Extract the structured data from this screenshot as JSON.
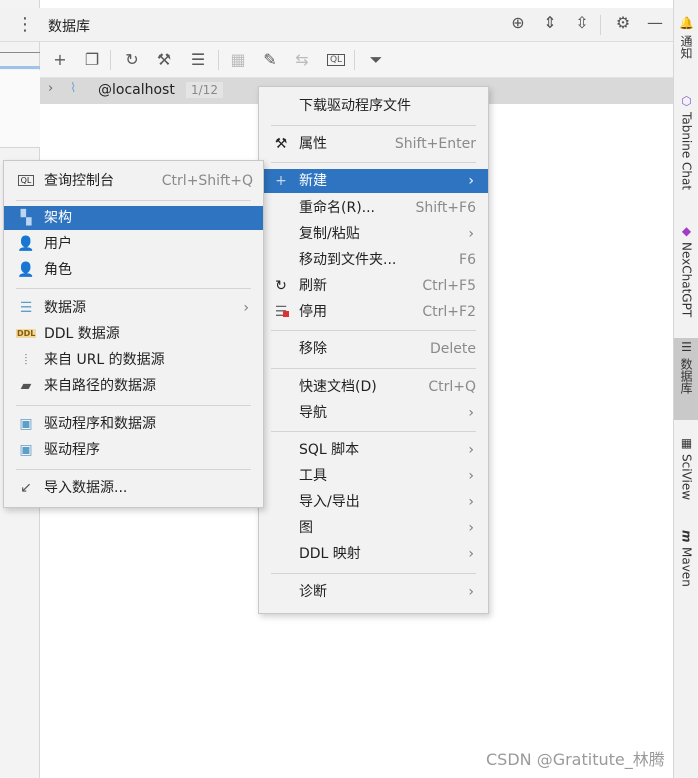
{
  "header": {
    "title": "数据库",
    "kebab_icon": "⋮"
  },
  "header_icons": [
    "crosshair-icon",
    "expand-all-icon",
    "collapse-all-icon",
    "settings-icon",
    "minimize-icon"
  ],
  "toolbar_icons": [
    "add-icon",
    "copy-icon",
    "refresh-icon",
    "properties-icon",
    "disable-datasource-icon",
    "table-icon",
    "edit-icon",
    "compare-icon",
    "query-console-icon",
    "filter-icon"
  ],
  "tree": {
    "host": "@localhost",
    "badge": "1/12"
  },
  "right_tabs": [
    {
      "label": "通知",
      "icon": "bell-icon"
    },
    {
      "label": "Tabnine Chat",
      "icon": "tabnine-icon"
    },
    {
      "label": "NexChatGPT",
      "icon": "nexchat-icon"
    },
    {
      "label": "数据库",
      "icon": "database-icon"
    },
    {
      "label": "SciView",
      "icon": "sciview-icon"
    },
    {
      "label": "Maven",
      "icon": "maven-icon"
    }
  ],
  "context_menu": {
    "items": [
      {
        "label": "下载驱动程序文件",
        "shortcut": ""
      },
      {
        "label": "属性",
        "shortcut": "Shift+Enter",
        "icon": "properties-icon"
      },
      {
        "label": "新建",
        "shortcut": "",
        "icon": "plus-icon"
      },
      {
        "label": "重命名(R)...",
        "shortcut": "Shift+F6"
      },
      {
        "label": "复制/粘贴",
        "shortcut": ""
      },
      {
        "label": "移动到文件夹...",
        "shortcut": "F6"
      },
      {
        "label": "刷新",
        "shortcut": "Ctrl+F5",
        "icon": "refresh-icon"
      },
      {
        "label": "停用",
        "shortcut": "Ctrl+F2",
        "icon": "disable-icon"
      },
      {
        "label": "移除",
        "shortcut": "Delete"
      },
      {
        "label": "快速文档(D)",
        "shortcut": "Ctrl+Q"
      },
      {
        "label": "导航",
        "shortcut": ""
      },
      {
        "label": "SQL 脚本",
        "shortcut": ""
      },
      {
        "label": "工具",
        "shortcut": ""
      },
      {
        "label": "导入/导出",
        "shortcut": ""
      },
      {
        "label": "图",
        "shortcut": ""
      },
      {
        "label": "DDL 映射",
        "shortcut": ""
      },
      {
        "label": "诊断",
        "shortcut": ""
      }
    ]
  },
  "submenu": {
    "items": [
      {
        "label": "查询控制台",
        "shortcut": "Ctrl+Shift+Q"
      },
      {
        "label": "架构",
        "shortcut": ""
      },
      {
        "label": "用户",
        "shortcut": ""
      },
      {
        "label": "角色",
        "shortcut": ""
      },
      {
        "label": "数据源",
        "shortcut": ""
      },
      {
        "label": "DDL 数据源",
        "shortcut": ""
      },
      {
        "label": "来自 URL 的数据源",
        "shortcut": ""
      },
      {
        "label": "来自路径的数据源",
        "shortcut": ""
      },
      {
        "label": "驱动程序和数据源",
        "shortcut": ""
      },
      {
        "label": "驱动程序",
        "shortcut": ""
      },
      {
        "label": "导入数据源...",
        "shortcut": ""
      }
    ]
  },
  "watermark": "CSDN @Gratitute_林腾",
  "colors": {
    "selection": "#2f74c0",
    "menu_bg": "#f2f2f2",
    "tree_row": "#d9d9d9"
  }
}
